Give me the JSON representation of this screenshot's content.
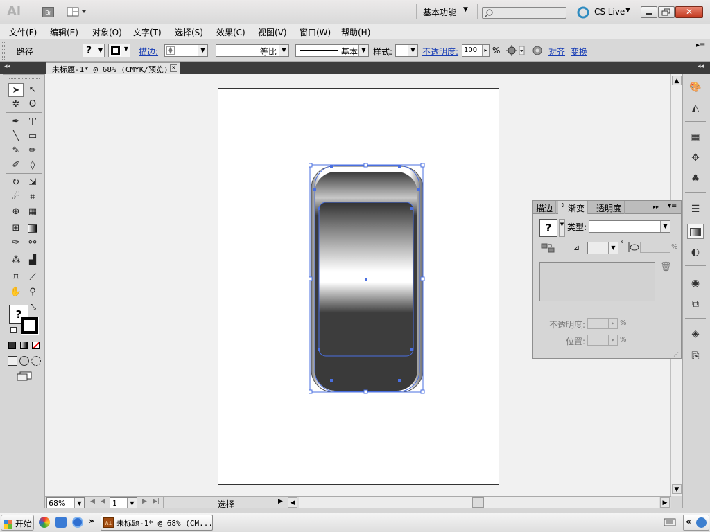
{
  "app": {
    "logo": "Ai",
    "bridge_label": "Br",
    "workspace": "基本功能",
    "search_placeholder": "",
    "cs_live": "CS Live"
  },
  "menu": [
    "文件(F)",
    "编辑(E)",
    "对象(O)",
    "文字(T)",
    "选择(S)",
    "效果(C)",
    "视图(V)",
    "窗口(W)",
    "帮助(H)"
  ],
  "control_bar": {
    "object_type": "路径",
    "fill_unknown": "?",
    "stroke_label": "描边:",
    "profile_label": "等比",
    "brush_label": "基本",
    "style_label": "样式:",
    "opacity_label": "不透明度:",
    "opacity_value": "100",
    "opacity_unit": "%",
    "align_label": "对齐",
    "transform_label": "变换"
  },
  "document_tab": {
    "title": "未标题-1* @ 68% (CMYK/预览)",
    "close": "×"
  },
  "toolbox": {
    "fill_unknown": "?"
  },
  "gradient_panel": {
    "tabs": [
      "描边",
      "渐变",
      "透明度"
    ],
    "active_tab": "渐变",
    "swatch_unknown": "?",
    "type_label": "类型:",
    "type_value": "",
    "angle_unit": "°",
    "aspect_unit": "%",
    "opacity_label": "不透明度:",
    "opacity_unit": "%",
    "location_label": "位置:",
    "location_unit": "%"
  },
  "status": {
    "zoom": "68%",
    "artboard": "1",
    "tool_name": "选择"
  },
  "taskbar": {
    "start_label": "开始",
    "task_label": "未标题-1* @ 68% (CM...",
    "chevron": "»"
  },
  "colors": {
    "selection": "#4a6fe0",
    "link": "#1a3fb5",
    "toolbox_bg": "#d6d6d6",
    "canvas_bg": "#f1f1f1"
  }
}
